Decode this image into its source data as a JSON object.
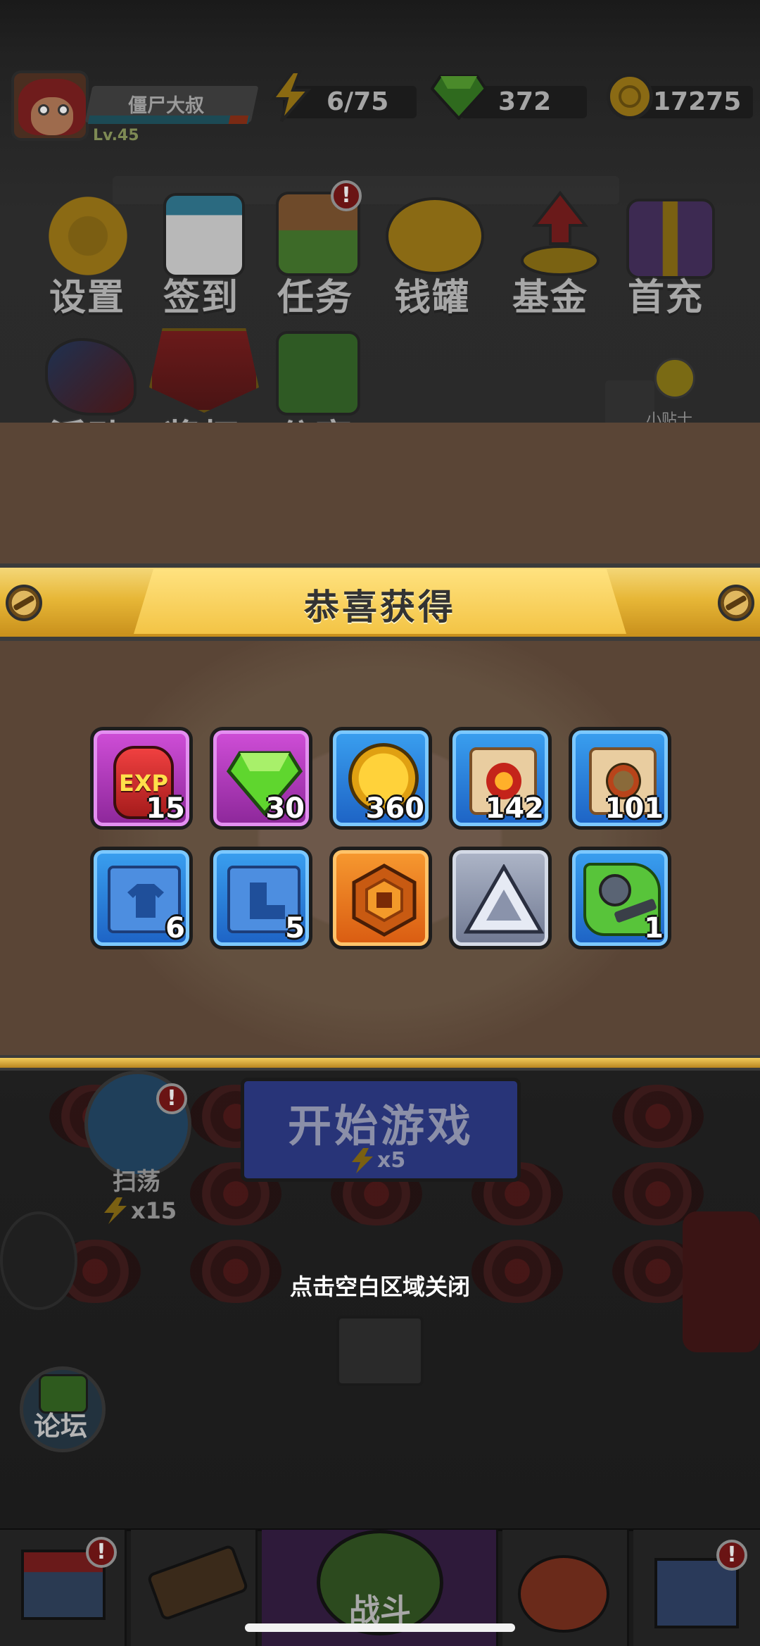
{
  "player": {
    "name": "僵尸大叔",
    "level": "Lv.45",
    "xp_fraction": 0.88
  },
  "resources": {
    "energy": "6/75",
    "gems": "372",
    "coins": "17275"
  },
  "menu": {
    "row1": [
      {
        "label": "设置",
        "icon": "gear-icon"
      },
      {
        "label": "签到",
        "icon": "calendar-icon"
      },
      {
        "label": "任务",
        "icon": "task-icon",
        "badge": "!"
      },
      {
        "label": "钱罐",
        "icon": "piggy-bank-icon"
      },
      {
        "label": "基金",
        "icon": "fund-icon"
      },
      {
        "label": "首充",
        "icon": "gift-box-icon"
      }
    ],
    "row2": [
      {
        "label": "活动",
        "icon": "event-cannon-icon"
      },
      {
        "label": "奖杯",
        "icon": "trophy-icon"
      },
      {
        "label": "分享",
        "icon": "share-icon"
      }
    ],
    "tips_label": "小贴士"
  },
  "reward_modal": {
    "title": "恭喜获得",
    "items": [
      {
        "icon": "exp-potion-icon",
        "icon_text": "EXP",
        "qty": "15",
        "rarity": "purple"
      },
      {
        "icon": "green-gem-icon",
        "qty": "30",
        "rarity": "purple"
      },
      {
        "icon": "gold-coin-icon",
        "qty": "360",
        "rarity": "blue"
      },
      {
        "icon": "fire-scroll-icon",
        "qty": "142",
        "rarity": "blue"
      },
      {
        "icon": "zombie-scroll-icon",
        "qty": "101",
        "rarity": "blue"
      },
      {
        "icon": "clothing-blueprint-icon",
        "qty": "6",
        "rarity": "blue"
      },
      {
        "icon": "boot-blueprint-icon",
        "qty": "5",
        "rarity": "blue"
      },
      {
        "icon": "orange-emblem-icon",
        "qty": "",
        "rarity": "orange"
      },
      {
        "icon": "silver-triangle-icon",
        "qty": "",
        "rarity": "gray"
      },
      {
        "icon": "gunner-puzzle-icon",
        "qty": "1",
        "rarity": "blue"
      }
    ],
    "close_hint": "点击空白区域关闭"
  },
  "lobby": {
    "start_label": "开始游戏",
    "start_cost": "x5",
    "sweep_label": "扫荡",
    "sweep_cost": "x15",
    "forum_label": "论坛",
    "battle_label": "战斗"
  },
  "colors": {
    "banner_gold": "#e7b737",
    "modal_bg": "#5a4536",
    "rarity_purple": "#b43ec2",
    "rarity_blue": "#2d7fdc",
    "rarity_orange": "#ea7a20",
    "rarity_gray": "#8d96ab"
  }
}
